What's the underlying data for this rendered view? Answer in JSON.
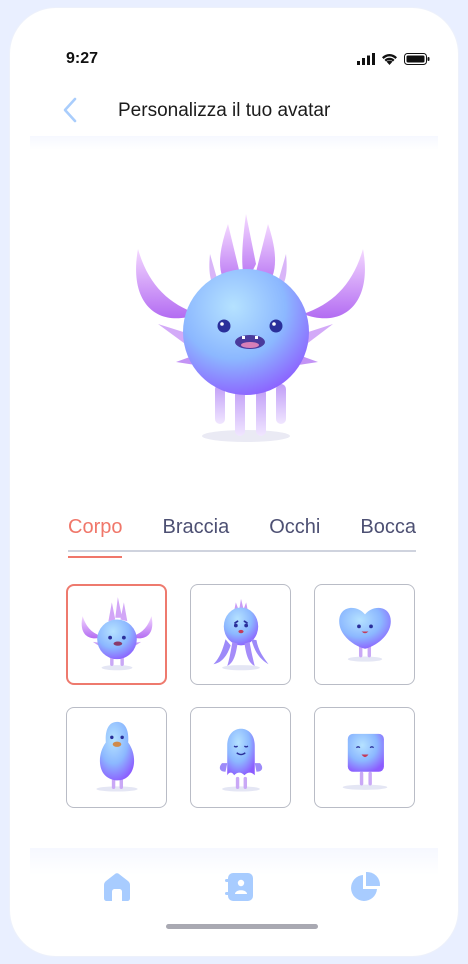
{
  "status": {
    "time": "9:27"
  },
  "header": {
    "title": "Personalizza il tuo avatar"
  },
  "tabs": [
    {
      "label": "Corpo",
      "active": true
    },
    {
      "label": "Braccia",
      "active": false
    },
    {
      "label": "Occhi",
      "active": false
    },
    {
      "label": "Bocca",
      "active": false
    }
  ],
  "body_options": [
    {
      "icon": "spiky-monster-icon",
      "selected": true
    },
    {
      "icon": "octopus-monster-icon",
      "selected": false
    },
    {
      "icon": "heart-monster-icon",
      "selected": false
    },
    {
      "icon": "bird-monster-icon",
      "selected": false
    },
    {
      "icon": "ghost-monster-icon",
      "selected": false
    },
    {
      "icon": "square-monster-icon",
      "selected": false
    }
  ],
  "nav": [
    "home-icon",
    "contacts-book-icon",
    "pie-chart-icon"
  ],
  "colors": {
    "accent": "#f0776a",
    "primary_light": "#a8ccff",
    "text": "#4d5073"
  }
}
